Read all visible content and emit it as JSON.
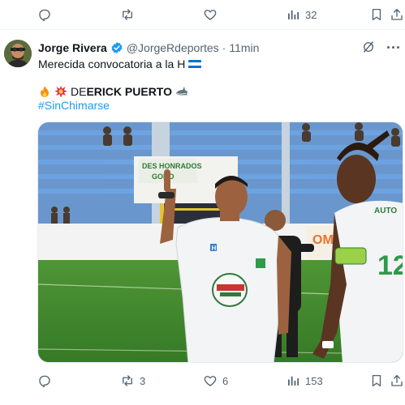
{
  "top_actions": {
    "reply_count": "",
    "repost_count": "",
    "like_count": "",
    "views_count": "32"
  },
  "tweet": {
    "author_name": "Jorge Rivera",
    "handle": "@JorgeRdeportes",
    "separator": "·",
    "time": "11min",
    "line1": "Merecida convocatoria a la H",
    "line2_prefix": "DE ",
    "line2_name": "ERICK PUERTO",
    "hashtag": "#SinChimarse",
    "media": {
      "banner_text": "DES HONRADOS",
      "banner_sub": "GODO",
      "ad_text": "OMAR",
      "jersey_number": "12",
      "jersey_sponsor": "AUTO",
      "shirt_logo": "H"
    },
    "actions": {
      "reply_count": "",
      "repost_count": "3",
      "like_count": "6",
      "views_count": "153"
    }
  },
  "colors": {
    "link": "#1d9bf0",
    "muted": "#536471",
    "verified": "#1d9bf0",
    "pitch": "#3f8a2e",
    "stands_blue": "#3f7fd0",
    "flag_blue": "#0073cf"
  },
  "icons": [
    "reply-icon",
    "repost-icon",
    "like-icon",
    "views-icon",
    "bookmark-icon",
    "share-icon",
    "grok-icon",
    "more-icon",
    "verified-icon",
    "fire-emoji",
    "collision-emoji",
    "shark-emoji",
    "honduras-flag"
  ]
}
